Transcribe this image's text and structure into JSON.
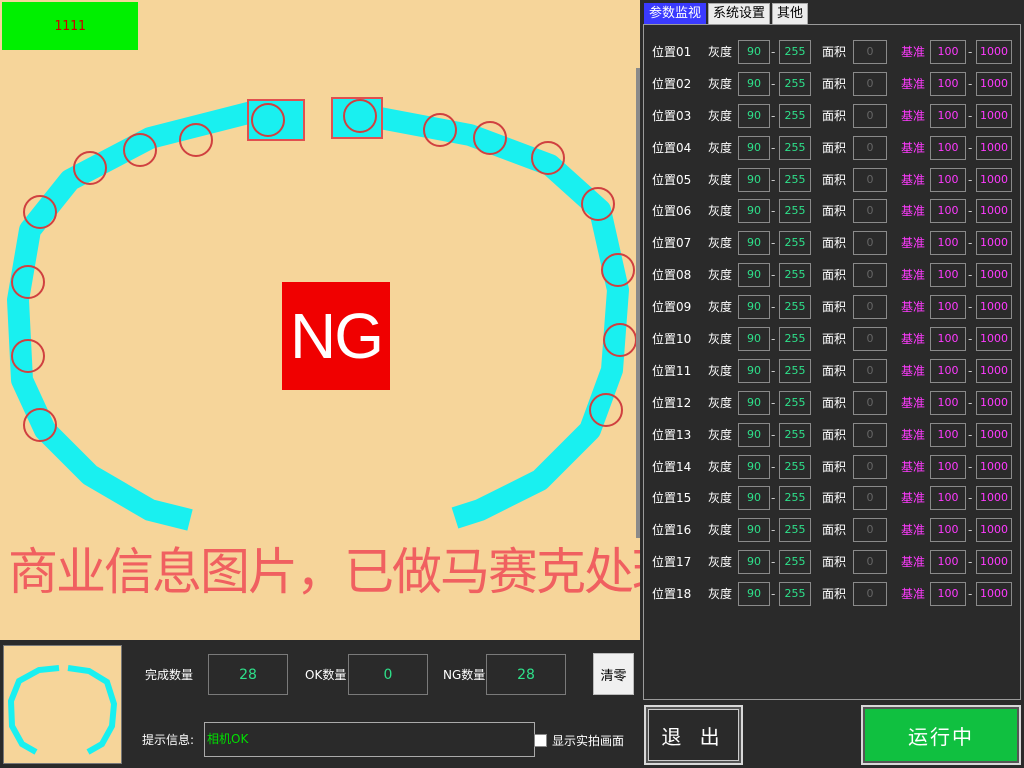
{
  "viewer": {
    "counter_badge": "1111",
    "result": "NG",
    "watermark": "商业信息图片，已做马赛克处理",
    "colors": {
      "background": "#f6d59a",
      "ring": "#19f0f0",
      "ng": "#f00000",
      "badge": "#00f000"
    }
  },
  "tabs": [
    {
      "label": "参数监视",
      "active": true
    },
    {
      "label": "系统设置",
      "active": false
    },
    {
      "label": "其他",
      "active": false
    }
  ],
  "labels": {
    "gray": "灰度",
    "area": "面积",
    "base": "基准",
    "dash": "-"
  },
  "positions": [
    {
      "name": "位置01",
      "gray_min": "90",
      "gray_max": "255",
      "area": "0",
      "base_min": "100",
      "base_max": "1000"
    },
    {
      "name": "位置02",
      "gray_min": "90",
      "gray_max": "255",
      "area": "0",
      "base_min": "100",
      "base_max": "1000"
    },
    {
      "name": "位置03",
      "gray_min": "90",
      "gray_max": "255",
      "area": "0",
      "base_min": "100",
      "base_max": "1000"
    },
    {
      "name": "位置04",
      "gray_min": "90",
      "gray_max": "255",
      "area": "0",
      "base_min": "100",
      "base_max": "1000"
    },
    {
      "name": "位置05",
      "gray_min": "90",
      "gray_max": "255",
      "area": "0",
      "base_min": "100",
      "base_max": "1000"
    },
    {
      "name": "位置06",
      "gray_min": "90",
      "gray_max": "255",
      "area": "0",
      "base_min": "100",
      "base_max": "1000"
    },
    {
      "name": "位置07",
      "gray_min": "90",
      "gray_max": "255",
      "area": "0",
      "base_min": "100",
      "base_max": "1000"
    },
    {
      "name": "位置08",
      "gray_min": "90",
      "gray_max": "255",
      "area": "0",
      "base_min": "100",
      "base_max": "1000"
    },
    {
      "name": "位置09",
      "gray_min": "90",
      "gray_max": "255",
      "area": "0",
      "base_min": "100",
      "base_max": "1000"
    },
    {
      "name": "位置10",
      "gray_min": "90",
      "gray_max": "255",
      "area": "0",
      "base_min": "100",
      "base_max": "1000"
    },
    {
      "name": "位置11",
      "gray_min": "90",
      "gray_max": "255",
      "area": "0",
      "base_min": "100",
      "base_max": "1000"
    },
    {
      "name": "位置12",
      "gray_min": "90",
      "gray_max": "255",
      "area": "0",
      "base_min": "100",
      "base_max": "1000"
    },
    {
      "name": "位置13",
      "gray_min": "90",
      "gray_max": "255",
      "area": "0",
      "base_min": "100",
      "base_max": "1000"
    },
    {
      "name": "位置14",
      "gray_min": "90",
      "gray_max": "255",
      "area": "0",
      "base_min": "100",
      "base_max": "1000"
    },
    {
      "name": "位置15",
      "gray_min": "90",
      "gray_max": "255",
      "area": "0",
      "base_min": "100",
      "base_max": "1000"
    },
    {
      "name": "位置16",
      "gray_min": "90",
      "gray_max": "255",
      "area": "0",
      "base_min": "100",
      "base_max": "1000"
    },
    {
      "name": "位置17",
      "gray_min": "90",
      "gray_max": "255",
      "area": "0",
      "base_min": "100",
      "base_max": "1000"
    },
    {
      "name": "位置18",
      "gray_min": "90",
      "gray_max": "255",
      "area": "0",
      "base_min": "100",
      "base_max": "1000"
    }
  ],
  "stats": {
    "done_label": "完成数量",
    "done_value": "28",
    "ok_label": "OK数量",
    "ok_value": "0",
    "ng_label": "NG数量",
    "ng_value": "28"
  },
  "clear_label": "清零",
  "tip": {
    "label": "提示信息:",
    "value": "相机OK"
  },
  "show_live": {
    "label": "显示实拍画面",
    "checked": false
  },
  "exit_label": "退 出",
  "run_label": "运行中",
  "accent": {
    "run": "#10c040",
    "active_tab": "#3a3aff",
    "value_text": "#2ee08a",
    "base_text": "#ff3aff"
  }
}
